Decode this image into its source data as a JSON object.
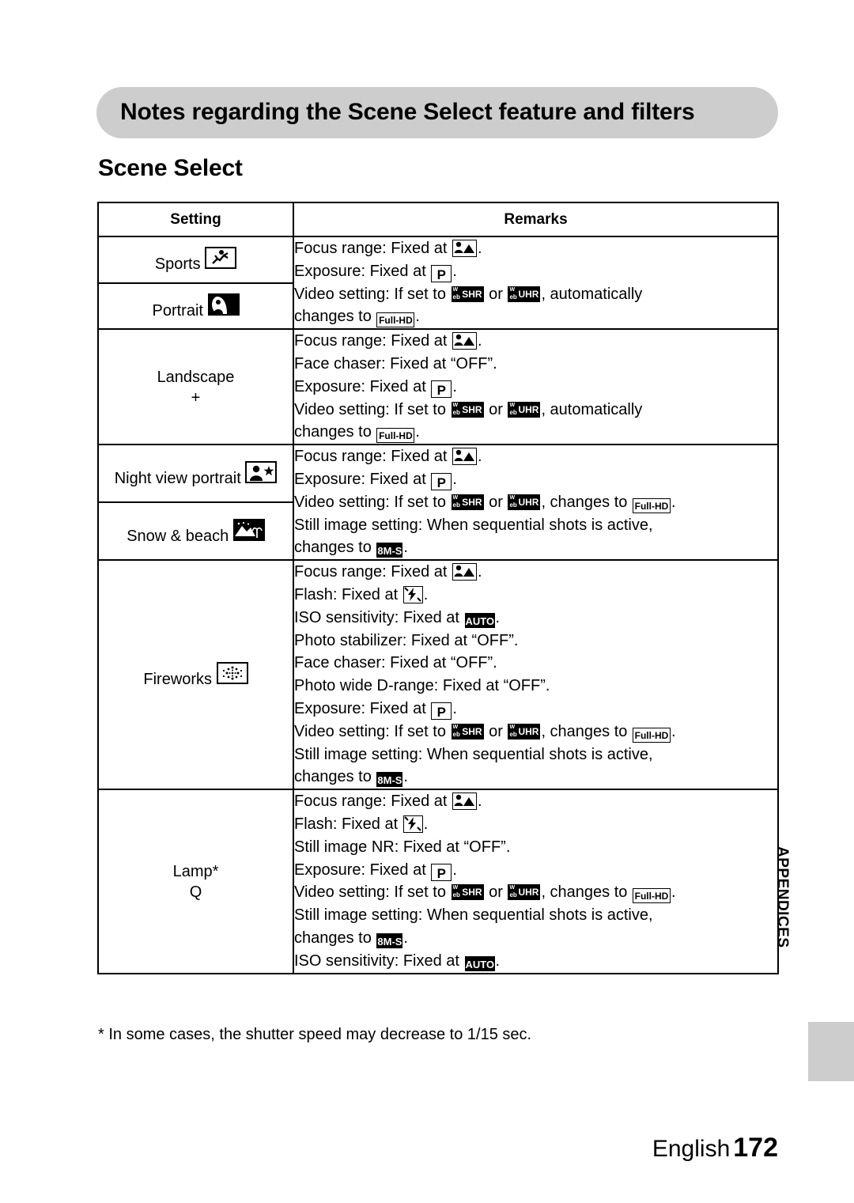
{
  "heading": "Notes regarding the Scene Select feature and filters",
  "subheading": "Scene Select",
  "table": {
    "headers": {
      "setting": "Setting",
      "remarks": "Remarks"
    },
    "rows": [
      {
        "settings": [
          {
            "label": "Sports",
            "icon": "sports-running-icon"
          },
          {
            "label": "Portrait",
            "icon": "portrait-person-icon"
          }
        ],
        "remarks": [
          "Focus range: Fixed at [focus-range-icon].",
          "Exposure: Fixed at [P].",
          "Video setting: If set to [WebSHR] or [WebUHR], automatically",
          "changes to [Full-HD]."
        ]
      },
      {
        "settings": [
          {
            "label": "Landscape",
            "icon": "landscape-icon",
            "glyph": "+"
          }
        ],
        "remarks": [
          "Focus range: Fixed at [focus-range-icon].",
          "Face chaser: Fixed at “OFF”.",
          "Exposure: Fixed at [P].",
          "Video setting: If set to [WebSHR] or [WebUHR], automatically",
          "changes to [Full-HD]."
        ]
      },
      {
        "settings": [
          {
            "label": "Night view portrait",
            "icon": "night-view-portrait-icon"
          },
          {
            "label": "Snow & beach",
            "icon": "snow-beach-icon"
          }
        ],
        "remarks": [
          "Focus range: Fixed at [focus-range-icon].",
          "Exposure: Fixed at [P].",
          "Video setting: If set to [WebSHR] or [WebUHR], changes to [Full-HD].",
          "Still image setting: When sequential shots is active,",
          "changes to [8M-S]."
        ]
      },
      {
        "settings": [
          {
            "label": "Fireworks",
            "icon": "fireworks-icon"
          }
        ],
        "remarks": [
          "Focus range: Fixed at [focus-range-icon].",
          "Flash: Fixed at [flash-off-icon].",
          "ISO sensitivity: Fixed at [AUTO].",
          "Photo stabilizer: Fixed at “OFF”.",
          "Face chaser: Fixed at “OFF”.",
          "Photo wide D-range: Fixed at “OFF”.",
          "Exposure: Fixed at [P].",
          "Video setting: If set to [WebSHR] or [WebUHR], changes to [Full-HD].",
          "Still image setting: When sequential shots is active,",
          "changes to [8M-S]."
        ]
      },
      {
        "settings": [
          {
            "label": "Lamp*",
            "icon": "lamp-icon",
            "glyph": "Q"
          }
        ],
        "remarks": [
          "Focus range: Fixed at [focus-range-icon].",
          "Flash: Fixed at [flash-off-icon].",
          "Still image NR: Fixed at “OFF”.",
          "Exposure: Fixed at [P].",
          "Video setting: If set to [WebSHR] or [WebUHR], changes to [Full-HD].",
          "Still image setting: When sequential shots is active,",
          "changes to [8M-S].",
          "ISO sensitivity: Fixed at [AUTO]."
        ]
      }
    ]
  },
  "labels": {
    "focus_range_prefix": "Focus range: Fixed at ",
    "exposure_prefix": "Exposure: Fixed at ",
    "flash_prefix": "Flash: Fixed at ",
    "iso_prefix": "ISO sensitivity: Fixed at ",
    "video_prefix": "Video setting: If set to ",
    "video_or": " or ",
    "video_auto_suffix": ", automatically",
    "video_changes_suffix": ", changes to ",
    "changes_to": "changes to ",
    "face_chaser": "Face chaser: Fixed at “OFF”.",
    "photo_stabilizer": "Photo stabilizer: Fixed at “OFF”.",
    "photo_wide_drange": "Photo wide D-range: Fixed at “OFF”.",
    "still_image_nr": "Still image NR: Fixed at “OFF”.",
    "still_image_setting": "Still image setting: When sequential shots is active,",
    "period": ".",
    "setting_sports": "Sports",
    "setting_portrait": "Portrait",
    "setting_landscape": "Landscape",
    "setting_landscape_glyph": "+",
    "setting_night": "Night view portrait",
    "setting_snow": "Snow & beach",
    "setting_fireworks": "Fireworks",
    "setting_lamp": "Lamp*",
    "setting_lamp_glyph": "Q"
  },
  "chips": {
    "p": "P",
    "auto": "AUTO",
    "full_hd": "Full-HD",
    "eight_m_s": "8M-S",
    "web_top": "W",
    "web_bottom": "eb",
    "shr": "SHR",
    "uhr": "UHR"
  },
  "footnote": "* In some cases, the shutter speed may decrease to 1/15 sec.",
  "footer": {
    "language": "English",
    "page": "172"
  },
  "side_tab": {
    "label": "APPENDICES"
  },
  "colors": {
    "pill": "#cdcdcd",
    "tab": "#cdcdcd",
    "text": "#000000"
  }
}
